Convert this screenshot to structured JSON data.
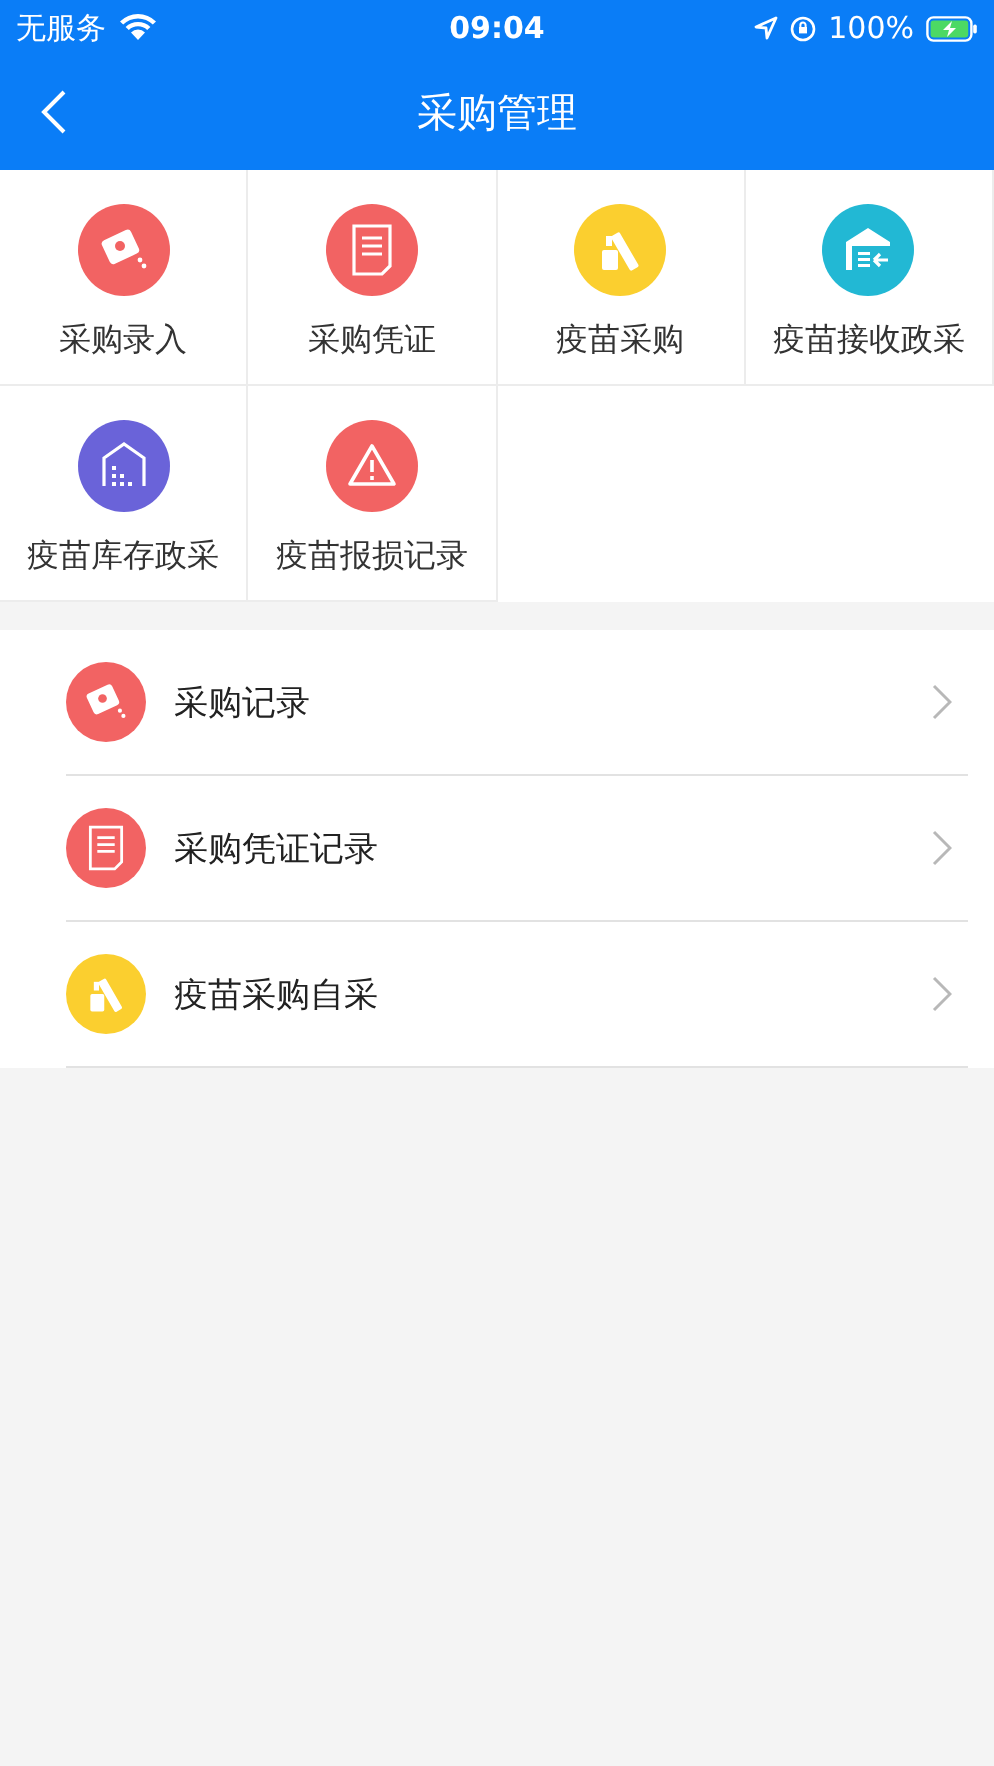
{
  "status_bar": {
    "carrier": "无服务",
    "time": "09:04",
    "battery": "100%"
  },
  "nav": {
    "title": "采购管理"
  },
  "grid": [
    {
      "label": "采购录入",
      "kind": "bag",
      "color": "#f26363"
    },
    {
      "label": "采购凭证",
      "kind": "document",
      "color": "#f26363"
    },
    {
      "label": "疫苗采购",
      "kind": "vaccine",
      "color": "#fbcf2f"
    },
    {
      "label": "疫苗接收政采",
      "kind": "warehouse",
      "color": "#22b8d4"
    },
    {
      "label": "疫苗库存政采",
      "kind": "house",
      "color": "#6a63d9"
    },
    {
      "label": "疫苗报损记录",
      "kind": "warning",
      "color": "#f26363"
    }
  ],
  "list": [
    {
      "label": "采购记录",
      "kind": "bag",
      "color": "#f26363"
    },
    {
      "label": "采购凭证记录",
      "kind": "document",
      "color": "#f26363"
    },
    {
      "label": "疫苗采购自采",
      "kind": "vaccine",
      "color": "#fbcf2f"
    }
  ]
}
